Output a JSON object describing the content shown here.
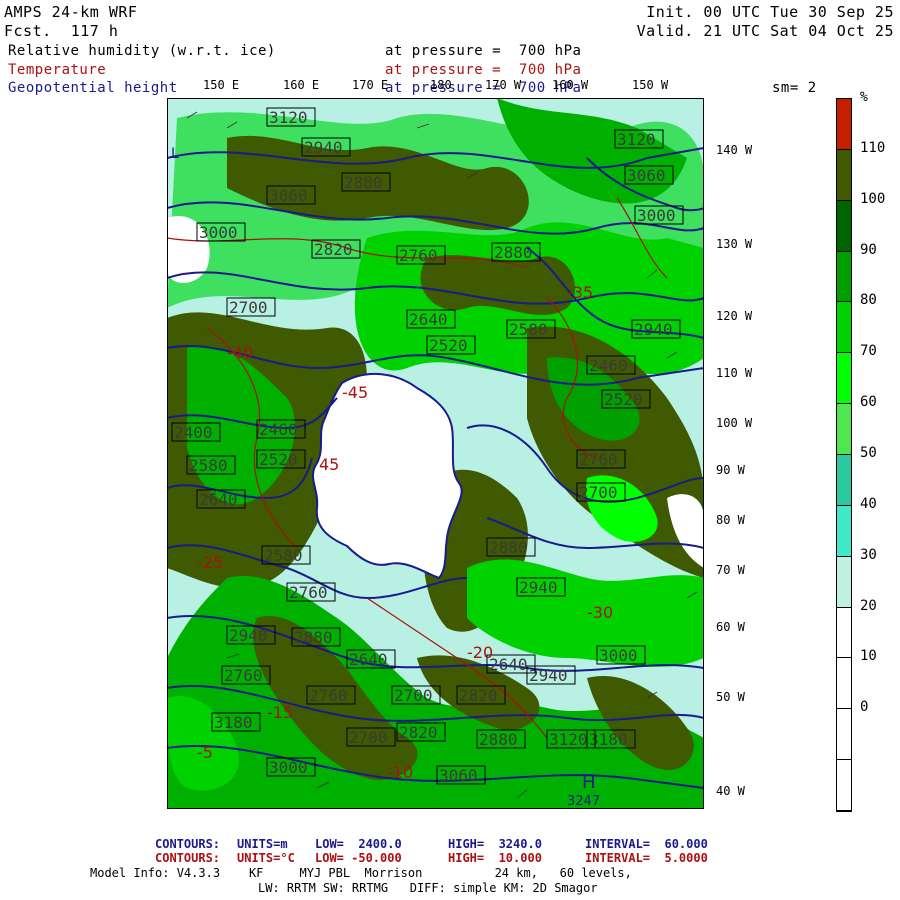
{
  "header": {
    "model": "AMPS 24-km WRF",
    "fcst": "Fcst.  117 h",
    "init": "Init. 00 UTC Tue 30 Sep 25",
    "valid": "Valid. 21 UTC Sat 04 Oct 25"
  },
  "fields": [
    {
      "name": "Relative humidity (w.r.t. ice)",
      "level": "at pressure =  700 hPa",
      "color": "#000000"
    },
    {
      "name": "Temperature",
      "level": "at pressure =  700 hPa",
      "color": "#aa1111"
    },
    {
      "name": "Geopotential height",
      "level": "at pressure =  700 hPa",
      "color": "#1a1a8c"
    }
  ],
  "smoothing": "sm= 2",
  "lon_labels_top": [
    "150 E",
    "160 E",
    "170 E",
    "180",
    "170 W",
    "160 W",
    "150 W"
  ],
  "lon_labels_right": [
    "140 W",
    "130 W",
    "120 W",
    "110 W",
    "100 W",
    "90 W",
    "80 W",
    "70 W",
    "60 W",
    "50 W",
    "40 W"
  ],
  "colorbar": {
    "unit": "%",
    "labels": [
      "110",
      "100",
      "90",
      "80",
      "70",
      "60",
      "50",
      "40",
      "30",
      "20",
      "10",
      "0"
    ],
    "colors": [
      "#c42000",
      "#3f5a00",
      "#006400",
      "#00a000",
      "#00d200",
      "#00ff00",
      "#50e650",
      "#2cc8a0",
      "#40e8c8",
      "#c0f0e0",
      "#ffffff",
      "#ffffff",
      "#ffffff",
      "#ffffff"
    ]
  },
  "contour_labels": {
    "height": [
      "3120",
      "2940",
      "2880",
      "3060",
      "3000",
      "2820",
      "2760",
      "2700",
      "2880",
      "2640",
      "2580",
      "2520",
      "2460",
      "2520",
      "2400",
      "2460",
      "2580",
      "2520",
      "2640",
      "2700",
      "2760",
      "2940",
      "3000",
      "3060",
      "3120",
      "3180",
      "3000",
      "2940",
      "2880",
      "2820",
      "2760",
      "2940",
      "2880",
      "2640",
      "2700",
      "2760",
      "3000",
      "3120",
      "3180",
      "3060",
      "2940",
      "2880",
      "2820",
      "2760",
      "2700",
      "2640",
      "2580"
    ],
    "temp": [
      "45",
      "-45",
      "-40",
      "-35",
      "-30",
      "-25",
      "-20",
      "-15",
      "-10",
      "-5"
    ],
    "extrema": [
      "L",
      "H",
      "3247"
    ]
  },
  "footer": {
    "line1_label": "CONTOURS:",
    "line1_units": "UNITS=m",
    "line1_low": "LOW=  2400.0",
    "line1_high": "HIGH=  3240.0",
    "line1_interval": "INTERVAL=  60.000",
    "line2_label": "CONTOURS:",
    "line2_units": "UNITS=°C",
    "line2_low": "LOW= -50.000",
    "line2_high": "HIGH=  10.000",
    "line2_interval": "INTERVAL=  5.0000",
    "line3": "Model Info: V4.3.3    KF     MYJ PBL  Morrison          24 km,   60 levels,",
    "line4": "LW: RRTM SW: RRTMG   DIFF: simple KM: 2D Smagor"
  }
}
